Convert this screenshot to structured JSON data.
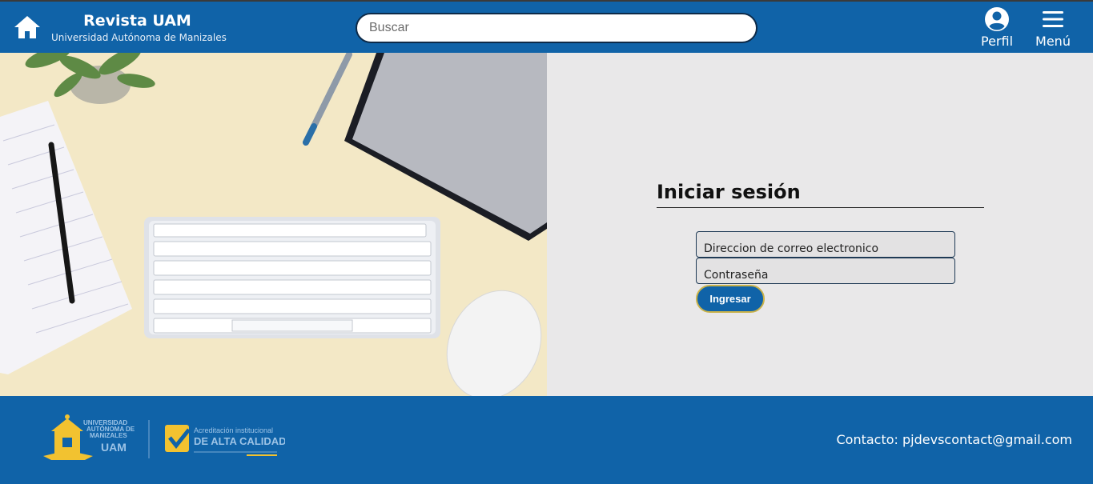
{
  "header": {
    "title": "Revista UAM",
    "subtitle": "Universidad Autónoma de Manizales",
    "search_placeholder": "Buscar",
    "profile_label": "Perfil",
    "menu_label": "Menú"
  },
  "login": {
    "title": "Iniciar sesión",
    "email_placeholder": "Direccion de correo electronico",
    "password_placeholder": "Contraseña",
    "submit_label": "Ingresar"
  },
  "footer": {
    "logo_uam_text": "UNIVERSIDAD AUTÓNOMA DE MANIZALES UAM",
    "logo_accreditation_line1": "Acreditación institucional",
    "logo_accreditation_line2": "DE ALTA CALIDAD",
    "contact": "Contacto: pjdevscontact@gmail.com"
  },
  "colors": {
    "brand_blue": "#1063a8",
    "panel_bg": "#e9e8e9",
    "accent_gold": "#c9b24a"
  },
  "icons": {
    "home": "home-icon",
    "profile": "user-circle-icon",
    "menu": "hamburger-icon"
  }
}
